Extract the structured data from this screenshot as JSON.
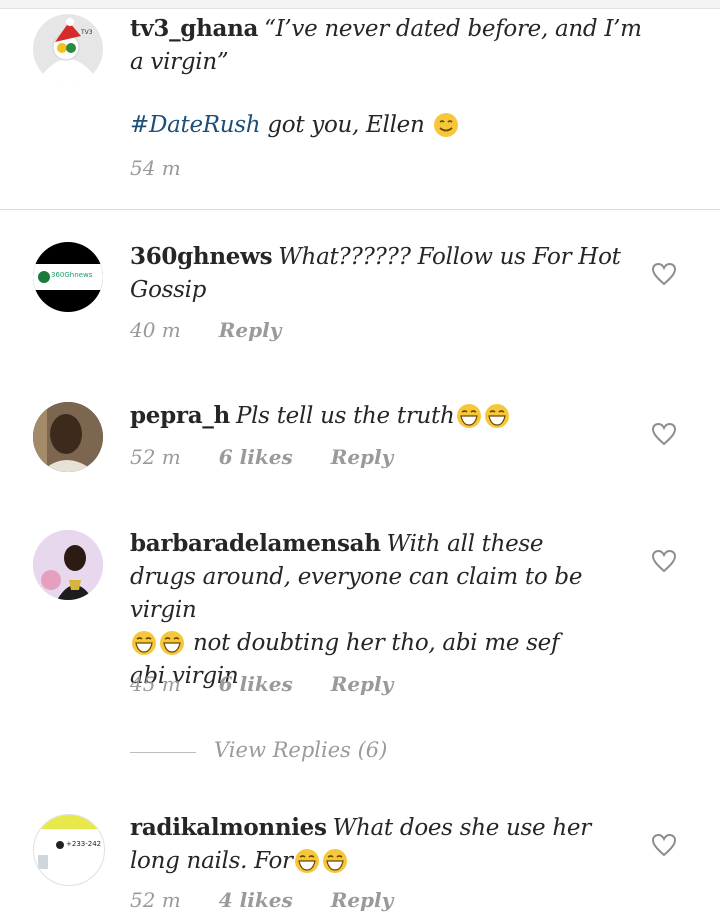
{
  "comments": [
    {
      "username": "tv3_ghana",
      "text": "“I’ve never dated before, and I’m a virgin”",
      "hashtag": "#DateRush",
      "text2": "got you, Ellen",
      "time": "54 m"
    },
    {
      "username": "360ghnews",
      "avatar_text": "360Ghnews",
      "text": "What?????? Follow us For Hot Gossip",
      "time": "40 m",
      "reply": "Reply"
    },
    {
      "username": "pepra_h",
      "text": "Pls tell us the truth",
      "time": "52 m",
      "likes": "6 likes",
      "reply": "Reply"
    },
    {
      "username": "barbaradelamensah",
      "text": "With all these drugs around, everyone can claim to be virgin",
      "text2": "not doubting her tho, abi me sef abi virgin",
      "time": "45 m",
      "likes": "6 likes",
      "reply": "Reply"
    },
    {
      "username": "radikalmonnies",
      "avatar_text": "+233-242",
      "text": "What does she use her long nails. For",
      "time": "52 m",
      "likes": "4 likes",
      "reply": "Reply"
    }
  ],
  "view_replies": "View Replies (6)",
  "colors": {
    "hashtag": "#1d4f7a",
    "meta": "#9a9a9a",
    "emoji": "#f6c73b"
  }
}
